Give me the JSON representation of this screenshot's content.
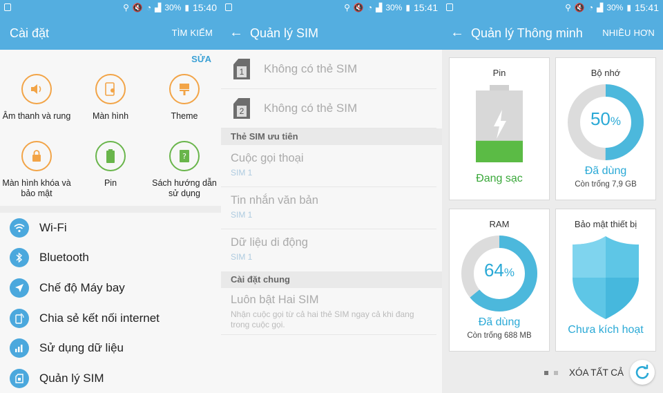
{
  "status": {
    "battery": "30%",
    "time_1": "15:40",
    "time_2": "15:41",
    "time_3": "15:41"
  },
  "settings": {
    "title": "Cài đặt",
    "search": "TÌM KIẾM",
    "edit": "SỬA",
    "grid": [
      {
        "label": "Âm thanh và rung",
        "icon": "speaker-icon"
      },
      {
        "label": "Màn hình",
        "icon": "display-icon"
      },
      {
        "label": "Theme",
        "icon": "paintbrush-icon"
      },
      {
        "label": "Màn hình khóa và bảo mật",
        "icon": "lock-icon"
      },
      {
        "label": "Pin",
        "icon": "battery-icon"
      },
      {
        "label": "Sách hướng dẫn sử dụng",
        "icon": "help-book-icon"
      }
    ],
    "list": [
      {
        "label": "Wi-Fi",
        "icon": "wifi-icon"
      },
      {
        "label": "Bluetooth",
        "icon": "bluetooth-icon"
      },
      {
        "label": "Chế độ Máy bay",
        "icon": "airplane-icon"
      },
      {
        "label": "Chia sẻ kết nối internet",
        "icon": "hotspot-icon"
      },
      {
        "label": "Sử dụng dữ liệu",
        "icon": "data-usage-icon"
      },
      {
        "label": "Quản lý SIM",
        "icon": "sim-icon"
      }
    ]
  },
  "sim": {
    "title": "Quản lý SIM",
    "sim1_label": "Không có thẻ SIM",
    "sim2_label": "Không có thẻ SIM",
    "sim1_num": "1",
    "sim2_num": "2",
    "section_preferred": "Thẻ SIM ưu tiên",
    "calls": "Cuộc gọi thoại",
    "calls_sim": "SIM 1",
    "sms": "Tin nhắn văn bản",
    "sms_sim": "SIM 1",
    "data": "Dữ liệu di động",
    "data_sim": "SIM 1",
    "section_general": "Cài đặt chung",
    "dual": "Luôn bật Hai SIM",
    "dual_desc": "Nhận cuộc gọi từ cả hai thẻ SIM ngay cả khi đang trong cuộc gọi."
  },
  "smart": {
    "title": "Quản lý Thông minh",
    "more": "NHIỀU HƠN",
    "battery": {
      "title": "Pin",
      "status": "Đang sạc",
      "level": 0.3
    },
    "storage": {
      "title": "Bộ nhớ",
      "percent_value": "50",
      "percent_sign": "%",
      "used_label": "Đã dùng",
      "free": "Còn trống 7,9 GB",
      "fraction": 0.5
    },
    "ram": {
      "title": "RAM",
      "percent_value": "64",
      "percent_sign": "%",
      "used_label": "Đã dùng",
      "free": "Còn trống 688 MB",
      "fraction": 0.64
    },
    "security": {
      "title": "Bảo mật thiết bị",
      "status": "Chưa kích hoạt"
    },
    "clear_all": "XÓA TẤT CẢ"
  },
  "colors": {
    "accent": "#54aee0",
    "orange": "#f2a447",
    "green": "#69b54b",
    "ring": "#4cb8dc",
    "ring_bg": "#dcdcdc"
  }
}
